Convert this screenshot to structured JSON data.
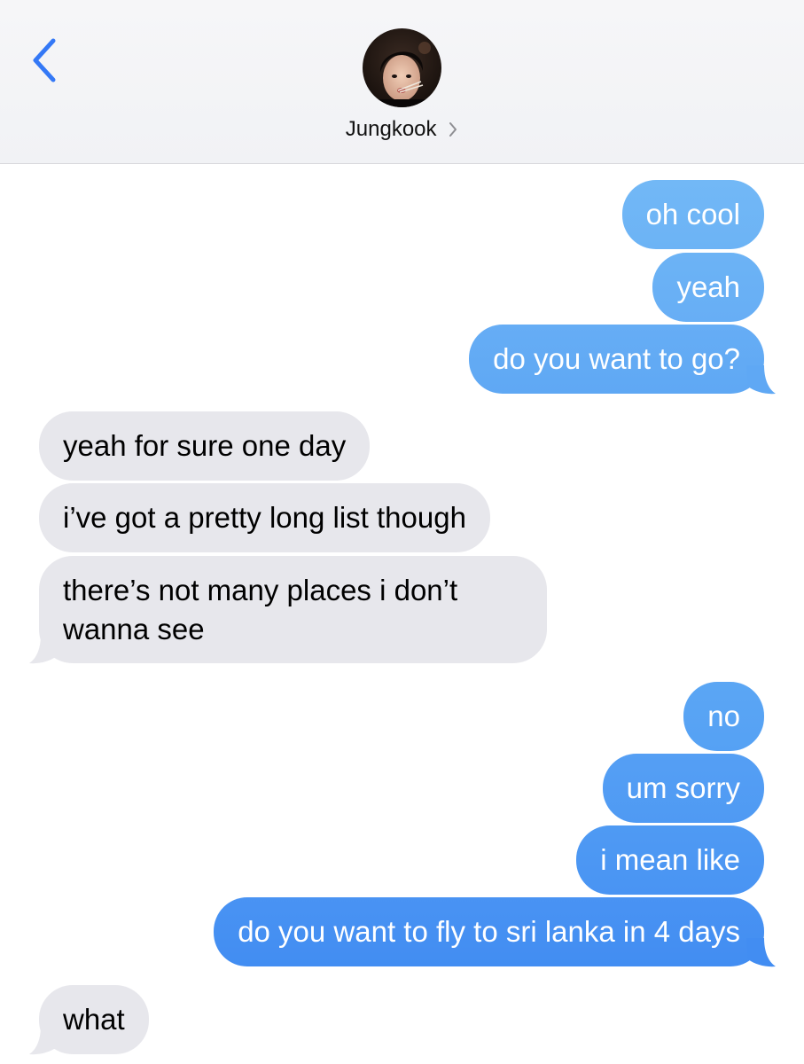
{
  "header": {
    "contact_name": "Jungkook",
    "back_icon": "chevron-left-icon",
    "disclosure_icon": "chevron-right-icon"
  },
  "colors": {
    "sent_top": "#6db4f5",
    "sent_bottom": "#3f8ef2",
    "received": "#e7e7ec",
    "back_accent": "#3478f6"
  },
  "messages": [
    {
      "from": "me",
      "text": "oh cool"
    },
    {
      "from": "me",
      "text": "yeah"
    },
    {
      "from": "me",
      "text": "do you want to go?"
    },
    {
      "from": "them",
      "text": "yeah for sure one day"
    },
    {
      "from": "them",
      "text": "i’ve got a pretty long list though"
    },
    {
      "from": "them",
      "text": "there’s not many places i don’t wanna see"
    },
    {
      "from": "me",
      "text": "no"
    },
    {
      "from": "me",
      "text": "um sorry"
    },
    {
      "from": "me",
      "text": "i mean like"
    },
    {
      "from": "me",
      "text": "do you want to fly to sri lanka in 4 days"
    },
    {
      "from": "them",
      "text": "what"
    }
  ]
}
